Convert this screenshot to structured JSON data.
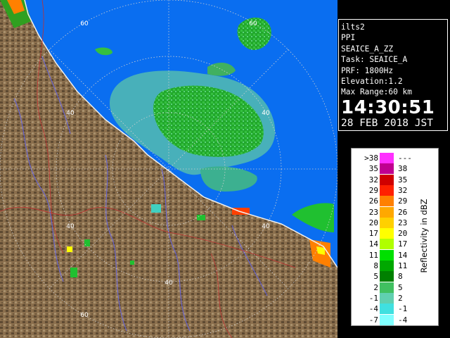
{
  "info": {
    "lines": [
      "ilts2",
      "PPI",
      "SEAICE_A_ZZ",
      "Task: SEAICE_A",
      "PRF: 1800Hz",
      "Elevation:1.2",
      "Max Range:60 km"
    ],
    "time": "14:30:51",
    "date": "28 FEB 2018 JST"
  },
  "range_labels": {
    "r60_top": "60",
    "r60_right": "60",
    "r60_bottom": "60",
    "r40_top": "40",
    "r40_right": "40",
    "r40_left": "40",
    "r40_bottom": "40"
  },
  "legend": {
    "title": "Reflectivity in dBZ",
    "rows": [
      {
        "lo": ">38",
        "hi": "---",
        "color": "#ff30ff"
      },
      {
        "lo": "35",
        "hi": "38",
        "color": "#c00090"
      },
      {
        "lo": "32",
        "hi": "35",
        "color": "#d00000"
      },
      {
        "lo": "29",
        "hi": "32",
        "color": "#ff2000"
      },
      {
        "lo": "26",
        "hi": "29",
        "color": "#ff8000"
      },
      {
        "lo": "23",
        "hi": "26",
        "color": "#ffa800"
      },
      {
        "lo": "20",
        "hi": "23",
        "color": "#ffd000"
      },
      {
        "lo": "17",
        "hi": "20",
        "color": "#ffff00"
      },
      {
        "lo": "14",
        "hi": "17",
        "color": "#b0ff00"
      },
      {
        "lo": "11",
        "hi": "14",
        "color": "#00e000"
      },
      {
        "lo": "8",
        "hi": "11",
        "color": "#00a800"
      },
      {
        "lo": "5",
        "hi": "8",
        "color": "#008000"
      },
      {
        "lo": "2",
        "hi": "5",
        "color": "#40c060"
      },
      {
        "lo": "-1",
        "hi": "2",
        "color": "#60d0b0"
      },
      {
        "lo": "-4",
        "hi": "-1",
        "color": "#40e0e0"
      },
      {
        "lo": "-7",
        "hi": "-4",
        "color": "#80ffff"
      }
    ]
  },
  "colors": {
    "sea": "#0a6ef0",
    "land": "#8a6e4c",
    "land_dark": "#4a3a28",
    "echo_green": "#1fa82a",
    "echo_teal": "#48b8a8",
    "river": "#5a5ad0",
    "boundary": "#c03030"
  }
}
